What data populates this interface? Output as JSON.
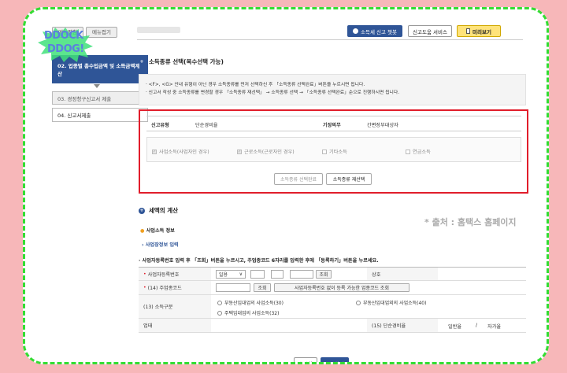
{
  "sidebar": {
    "tabs": [
      "메뉴펼침",
      "메뉴접기"
    ],
    "sticker": {
      "line1": "DDOCK",
      "line2": "DDOG!"
    },
    "items": [
      {
        "label": "02. 업종별 총수입금액 및 소득금액계산"
      },
      {
        "label": "03. 경정청구신고서 제출"
      },
      {
        "label": "04. 신고서제출"
      }
    ]
  },
  "header": {
    "chat_button": "소득세 신고 챗봇",
    "help_button": "신고도움 서비스",
    "preview_button": "미리보기"
  },
  "income_type_section": {
    "title": "소득종류 선택(복수선택 가능)",
    "notices": [
      "· <F>, <G> 안내 유형이 아닌 경우 소득종류를 먼저 선택하신 후 「소득종류 선택완료」버튼을 누르시면 됩니다.",
      "· 신고서 작성 중 소득종류를 변경할 경우 「소득종류 재선택」 → 소득종류 선택 → 「소득종류 선택완료」순으로 진행하시면 됩니다."
    ],
    "filing_type_label": "신고유형",
    "filing_type_value": "단순경비율",
    "bookkeeping_label": "기장의무",
    "bookkeeping_value": "간편장부대상자",
    "checkboxes": [
      {
        "label": "사업소득(사업자인 경우)",
        "checked": true
      },
      {
        "label": "근로소득(근로자인 경우)",
        "checked": true
      },
      {
        "label": "기타소득",
        "checked": false
      },
      {
        "label": "연금소득",
        "checked": false
      }
    ],
    "complete_button": "소득종류 선택완료",
    "reselect_button": "소득종류 재선택"
  },
  "tax_calc_section": {
    "title": "세액의 계산",
    "source_note": "* 출처 : 홈택스 홈페이지",
    "business_info": "사업소득 정보",
    "business_input_link": "사업장정보 입력",
    "guide": "· 사업자등록번호 입력 후 「조회」버튼을 누르시고, 주업종코드 6자리를 입력한 후에 「등록하기」버튼을 누르세요.",
    "form": {
      "bizno_label": "사업자등록번호",
      "bizno_select": "일용",
      "lookup_button": "조회",
      "company_label": "상호",
      "industry_label": "(14) 주업종코드",
      "industry_lookup_button": "조회",
      "industry_register_button": "사업자등록번호 없이 등록 가능한 업종코드 조회",
      "income_category_label": "(13) 소득구분",
      "radios": [
        "부동산임대업의 사업소득(30)",
        "부동산임대업외의 사업소득(40)",
        "주택임대업의 사업소득(32)"
      ],
      "business_label": "업태",
      "expense_rate_label": "(15) 단순경비율",
      "expense_general": "일반율",
      "expense_sep": "/",
      "expense_self": "자가율"
    },
    "reset_button": "초기화",
    "register_button": "등록하기"
  }
}
